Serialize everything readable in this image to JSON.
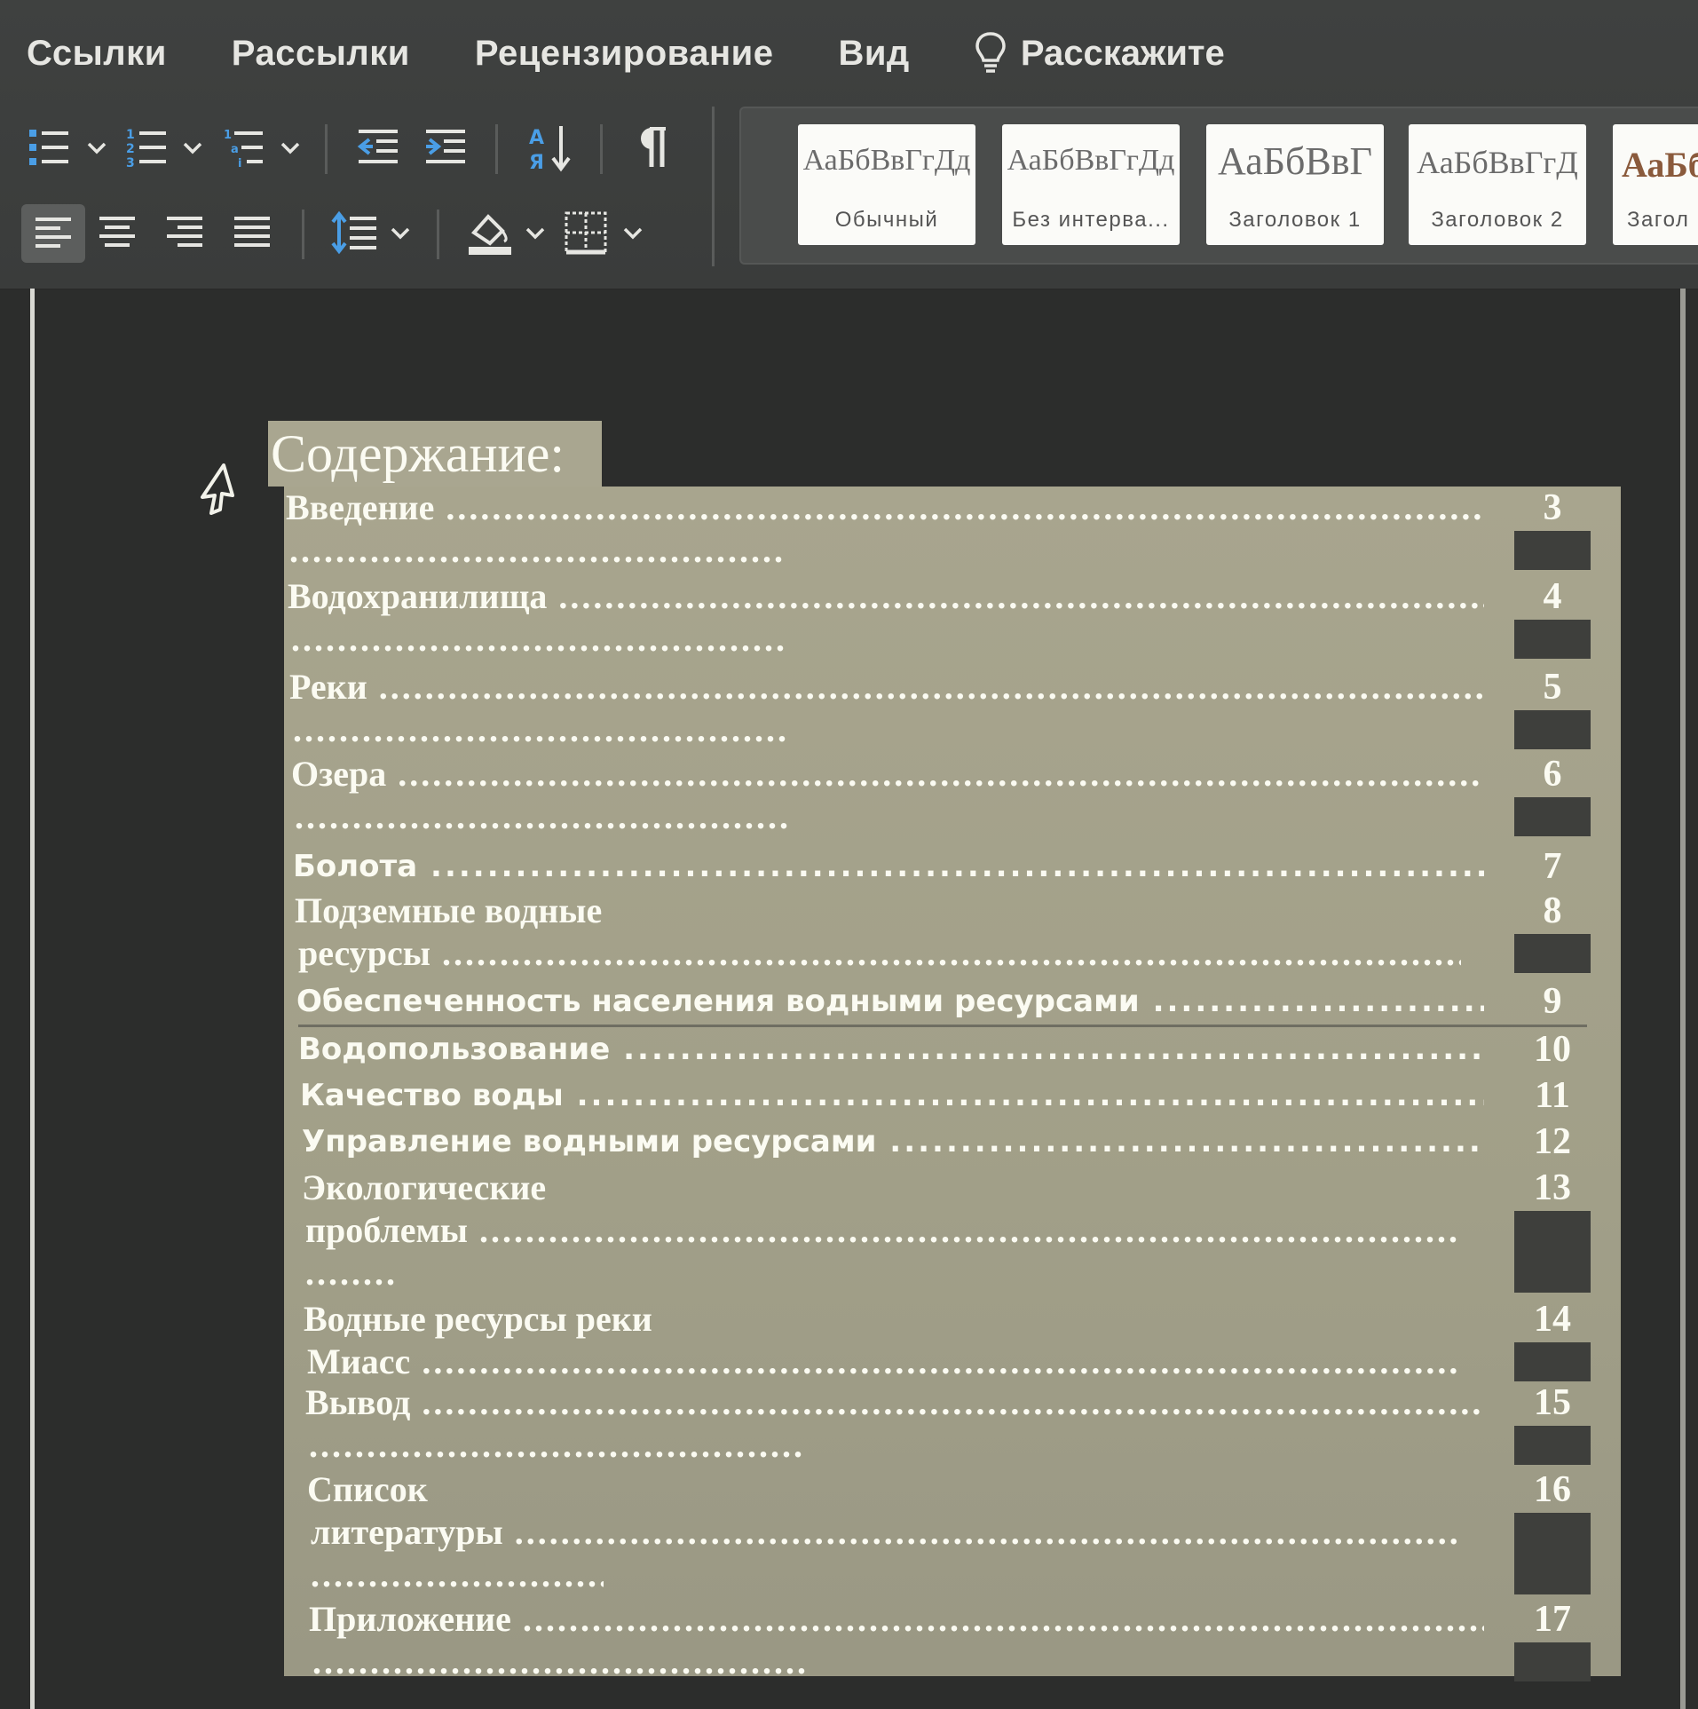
{
  "ribbon": {
    "tabs": [
      "Ссылки",
      "Рассылки",
      "Рецензирование",
      "Вид"
    ],
    "tell_me": "Расскажите",
    "styles": [
      {
        "sample": "АаБбВвГгДд",
        "name": "Обычный"
      },
      {
        "sample": "АаБбВвГгДд",
        "name": "Без интерва..."
      },
      {
        "sample": "АаБбВвГ",
        "name": "Заголовок 1"
      },
      {
        "sample": "АаБбВвГгД",
        "name": "Заголовок 2"
      },
      {
        "sample": "АаБб",
        "name": "Загол"
      }
    ],
    "icons": [
      "bullet-list-icon",
      "numbered-list-icon",
      "multilevel-list-icon",
      "decrease-indent-icon",
      "increase-indent-icon",
      "sort-icon",
      "pilcrow-icon",
      "align-left-icon",
      "align-center-icon",
      "align-right-icon",
      "justify-icon",
      "line-spacing-icon",
      "shading-icon",
      "borders-icon",
      "lightbulb-icon"
    ]
  },
  "document": {
    "toc_title": "Содержание:",
    "entries": [
      {
        "line1": "Введение",
        "line1_dots": true,
        "line2": "",
        "line3": "",
        "page": "3",
        "font": "serif"
      },
      {
        "line1": "Водохранилища",
        "line1_dots": true,
        "line2": "",
        "line3": "",
        "page": "4",
        "font": "serif"
      },
      {
        "line1": "Реки",
        "line1_dots": true,
        "line2": "",
        "line3": "",
        "page": "5",
        "font": "serif"
      },
      {
        "line1": "Озера",
        "line1_dots": true,
        "line2": "",
        "line3": "",
        "page": "6",
        "font": "serif"
      },
      {
        "line1": "Болота",
        "line1_dots": true,
        "line2": "",
        "line3": "",
        "page": "7",
        "font": "sans"
      },
      {
        "line1": "Подземные водные",
        "line1_dots": false,
        "line2": "ресурсы",
        "line3": "",
        "page": "8",
        "font": "serif"
      },
      {
        "line1": "Обеспеченность населения водными ресурсами",
        "line1_dots": true,
        "line2": "",
        "line3": "",
        "page": "9",
        "font": "sans"
      },
      {
        "line1": "Водопользование",
        "line1_dots": true,
        "line2": "",
        "line3": "",
        "page": "10",
        "font": "sans"
      },
      {
        "line1": "Качество воды",
        "line1_dots": true,
        "line2": "",
        "line3": "",
        "page": "11",
        "font": "sans"
      },
      {
        "line1": "Управление водными ресурсами",
        "line1_dots": true,
        "line2": "",
        "line3": "",
        "page": "12",
        "font": "sans"
      },
      {
        "line1": "Экологические",
        "line1_dots": false,
        "line2": "проблемы",
        "line3": "",
        "page": "13",
        "font": "serif"
      },
      {
        "line1": "Водные ресурсы реки",
        "line1_dots": false,
        "line2": "Миасс",
        "line3": "",
        "page": "14",
        "font": "serif"
      },
      {
        "line1": "Вывод",
        "line1_dots": true,
        "line2": "",
        "line3": "",
        "page": "15",
        "font": "serif"
      },
      {
        "line1": "Список",
        "line1_dots": false,
        "line2": "литературы",
        "line3": "",
        "page": "16",
        "font": "serif"
      },
      {
        "line1": "Приложение",
        "line1_dots": true,
        "line2": "",
        "line3": "",
        "page": "17",
        "font": "serif"
      }
    ]
  },
  "colors": {
    "ribbon_bg": "#3f4140",
    "selection_bg": "#a8a58e",
    "text": "#fbfbf2",
    "accent_blue": "#4a9ee6"
  }
}
